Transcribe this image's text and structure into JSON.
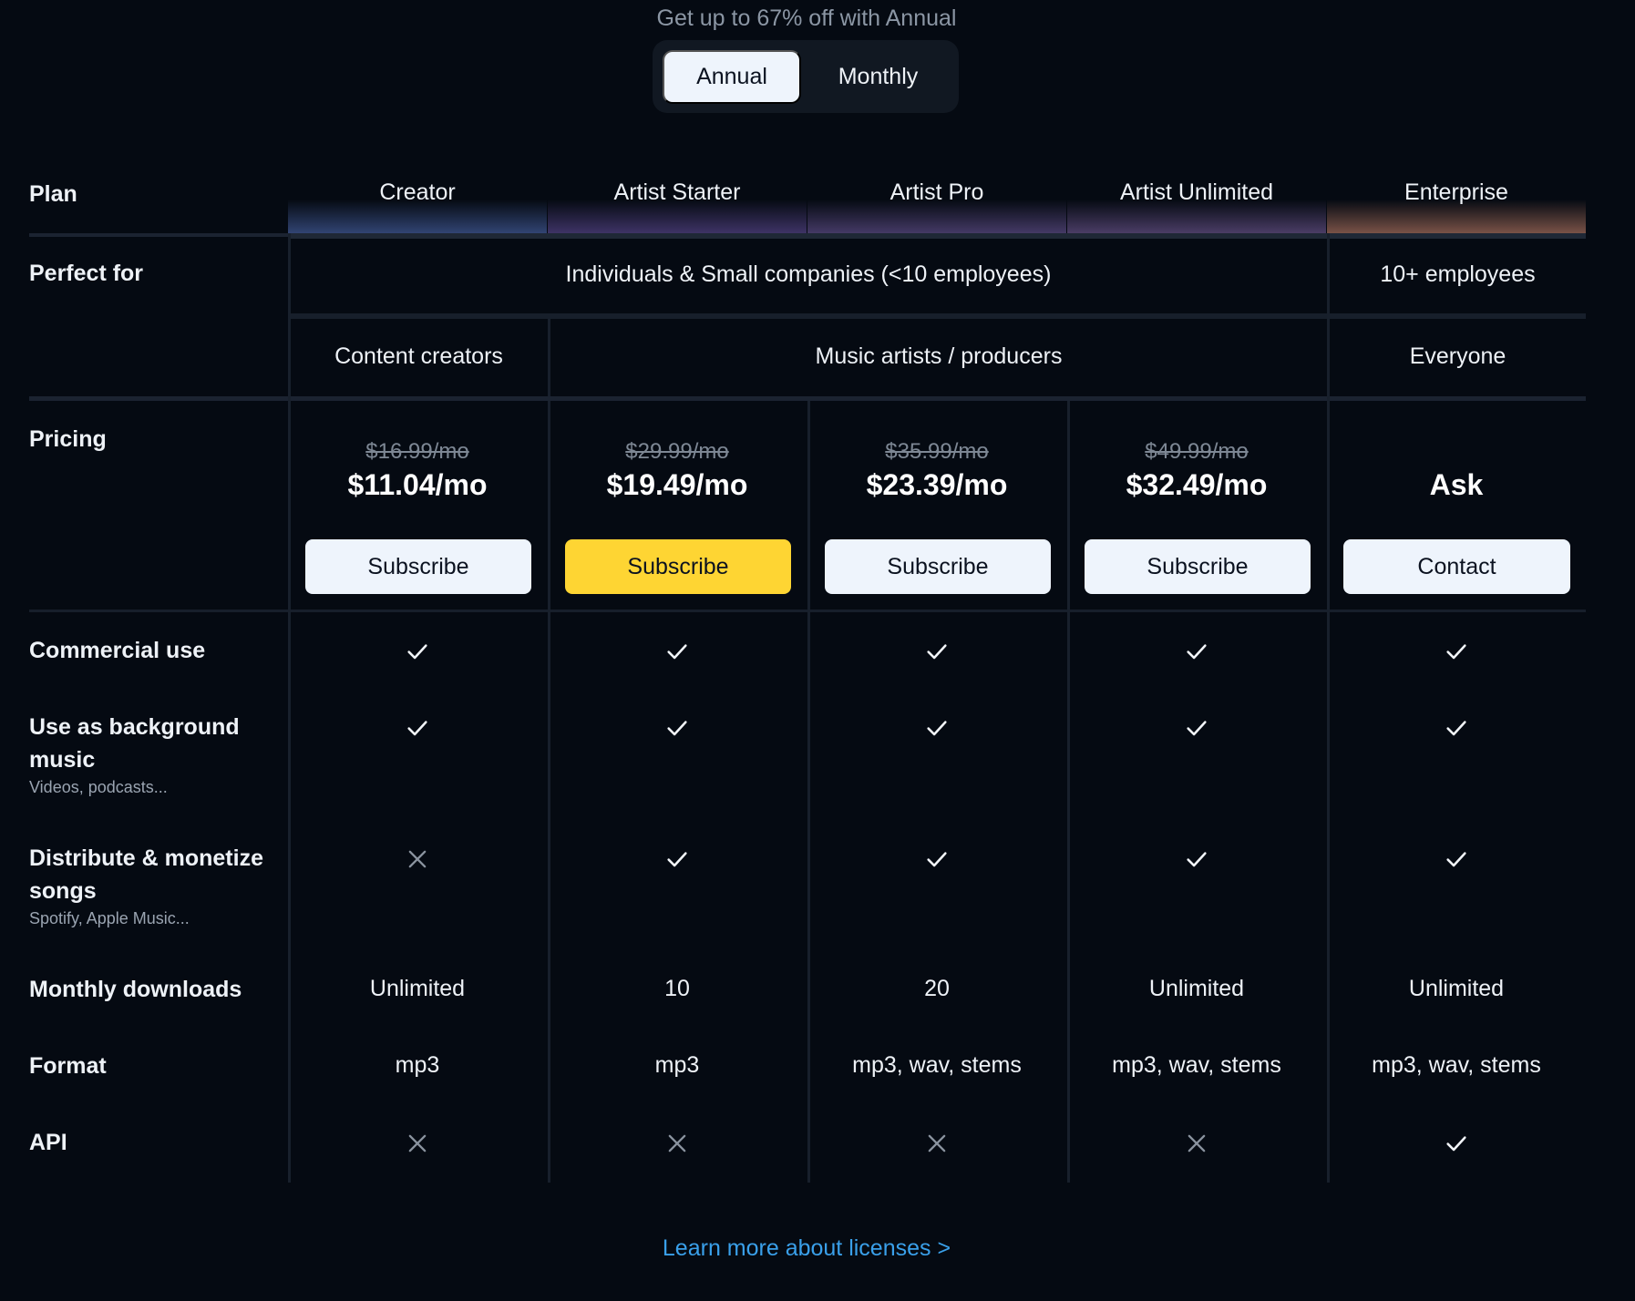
{
  "promo": {
    "tagline": "Get up to 67% off with Annual"
  },
  "billing_toggle": {
    "annual_label": "Annual",
    "monthly_label": "Monthly",
    "selected": "Annual"
  },
  "table": {
    "plan_label": "Plan",
    "plans": [
      {
        "name": "Creator",
        "old_price": "$16.99/mo",
        "price": "$11.04/mo",
        "button": "Subscribe"
      },
      {
        "name": "Artist Starter",
        "old_price": "$29.99/mo",
        "price": "$19.49/mo",
        "button": "Subscribe"
      },
      {
        "name": "Artist Pro",
        "old_price": "$35.99/mo",
        "price": "$23.39/mo",
        "button": "Subscribe"
      },
      {
        "name": "Artist Unlimited",
        "old_price": "$49.99/mo",
        "price": "$32.49/mo",
        "button": "Subscribe"
      },
      {
        "name": "Enterprise",
        "old_price": "",
        "price": "Ask",
        "button": "Contact"
      }
    ],
    "perfect_for": {
      "label": "Perfect for",
      "group1": "Individuals & Small companies (<10 employees)",
      "group2": "10+ employees",
      "audience1": "Content creators",
      "audience2": "Music artists / producers",
      "audience3": "Everyone"
    },
    "pricing_label": "Pricing",
    "features": {
      "commercial_use": {
        "label": "Commercial use",
        "values": [
          "check",
          "check",
          "check",
          "check",
          "check"
        ]
      },
      "background_music": {
        "label": "Use as background music",
        "sub": "Videos, podcasts...",
        "values": [
          "check",
          "check",
          "check",
          "check",
          "check"
        ]
      },
      "distribute": {
        "label": "Distribute & monetize songs",
        "sub": "Spotify, Apple Music...",
        "values": [
          "cross",
          "check",
          "check",
          "check",
          "check"
        ]
      },
      "downloads": {
        "label": "Monthly downloads",
        "values": [
          "Unlimited",
          "10",
          "20",
          "Unlimited",
          "Unlimited"
        ]
      },
      "format": {
        "label": "Format",
        "values": [
          "mp3",
          "mp3",
          "mp3, wav, stems",
          "mp3, wav, stems",
          "mp3, wav, stems"
        ]
      },
      "api": {
        "label": "API",
        "values": [
          "cross",
          "cross",
          "cross",
          "cross",
          "check"
        ]
      }
    }
  },
  "footer": {
    "learn_more": "Learn more about licenses >"
  },
  "colors": {
    "background": "#050a12",
    "highlight_button": "#fed533",
    "link": "#3aa0ea"
  }
}
